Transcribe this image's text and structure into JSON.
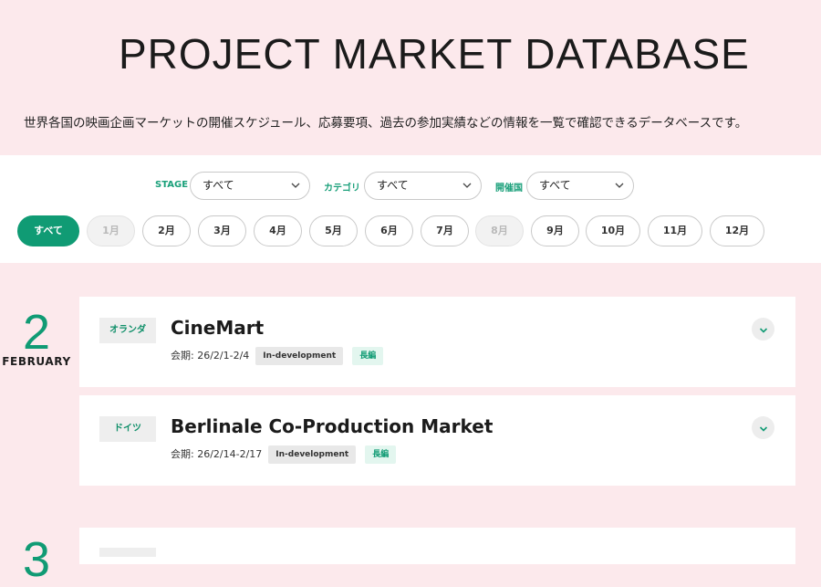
{
  "header": {
    "title": "PROJECT MARKET DATABASE",
    "description": "世界各国の映画企画マーケットの開催スケジュール、応募要項、過去の参加実績などの情報を一覧で確認できるデータベースです。"
  },
  "filters": {
    "stage": {
      "label": "STAGE",
      "value": "すべて"
    },
    "category": {
      "label": "カテゴリ",
      "value": "すべて"
    },
    "country": {
      "label": "開催国",
      "value": "すべて"
    }
  },
  "months": [
    {
      "label": "すべて",
      "state": "active"
    },
    {
      "label": "1月",
      "state": "disabled"
    },
    {
      "label": "2月",
      "state": "default"
    },
    {
      "label": "3月",
      "state": "default"
    },
    {
      "label": "4月",
      "state": "default"
    },
    {
      "label": "5月",
      "state": "default"
    },
    {
      "label": "6月",
      "state": "default"
    },
    {
      "label": "7月",
      "state": "default"
    },
    {
      "label": "8月",
      "state": "disabled"
    },
    {
      "label": "9月",
      "state": "default"
    },
    {
      "label": "10月",
      "state": "default"
    },
    {
      "label": "11月",
      "state": "default"
    },
    {
      "label": "12月",
      "state": "default"
    }
  ],
  "groups": [
    {
      "number": "2",
      "name": "FEBRUARY",
      "markets": [
        {
          "country": "オランダ",
          "title": "CineMart",
          "period": "会期: 26/2/1-2/4",
          "stage": "In-development",
          "category": "長編"
        },
        {
          "country": "ドイツ",
          "title": "Berlinale Co-Production Market",
          "period": "会期: 26/2/14-2/17",
          "stage": "In-development",
          "category": "長編"
        }
      ]
    },
    {
      "number": "3"
    }
  ],
  "colors": {
    "accent": "#109b74",
    "background": "#fce9ec",
    "card": "#ffffff"
  },
  "icons": {
    "select_chevron": "chevron-down-icon",
    "expand": "chevron-down-icon"
  }
}
